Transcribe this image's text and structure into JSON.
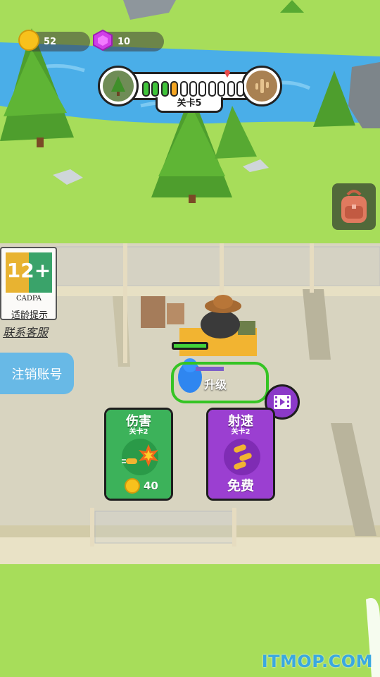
{
  "hud": {
    "coins": "52",
    "gems": "10"
  },
  "level": {
    "label": "关卡5",
    "progress_filled": 3,
    "progress_current": 4,
    "progress_total": 11
  },
  "age_rating": {
    "age": "12+",
    "org": "CADPA",
    "caption": "适龄提示"
  },
  "links": {
    "contact_service": "联系客服",
    "cancel_account": "注销账号"
  },
  "upgrade_zone": {
    "label": "升级"
  },
  "cards": {
    "damage": {
      "title": "伤害",
      "sub": "关卡2",
      "price": "40",
      "color": "#3cb25a"
    },
    "fire_rate": {
      "title": "射速",
      "sub": "关卡2",
      "price": "免费",
      "color": "#9b3fd1"
    }
  },
  "watermark": "ITMOP.COM",
  "icons": [
    "coin-icon",
    "gem-icon",
    "tree-icon",
    "desert-icon",
    "backpack-icon",
    "video-ad-icon",
    "explosion-bullet-icon",
    "triple-bullet-icon"
  ]
}
